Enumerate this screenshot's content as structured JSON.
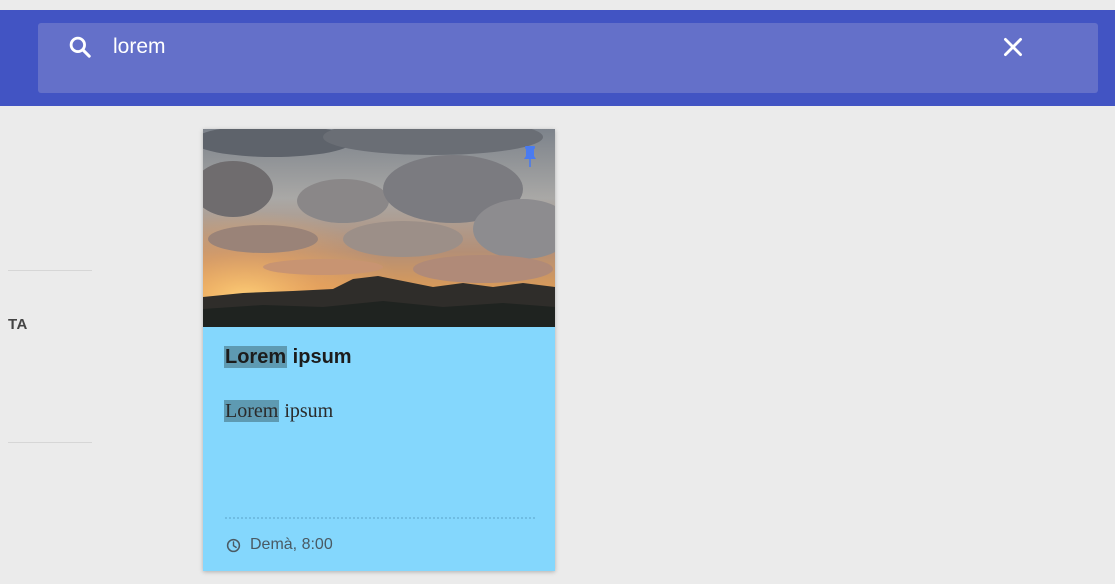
{
  "search": {
    "query": "lorem"
  },
  "sidebar": {
    "partial_label": "TA"
  },
  "note": {
    "title_highlight": "Lorem",
    "title_rest": " ipsum",
    "body_highlight": "Lorem",
    "body_rest": " ipsum",
    "reminder": "Demà, 8:00",
    "pinned": true,
    "background_color": "#84d7fd"
  },
  "colors": {
    "header": "#4254c3",
    "search_box": "#6470c9",
    "highlight": "#5e9ab2",
    "pin": "#4a7bf0"
  },
  "icons": [
    "search-icon",
    "close-icon",
    "pin-icon",
    "clock-icon"
  ]
}
